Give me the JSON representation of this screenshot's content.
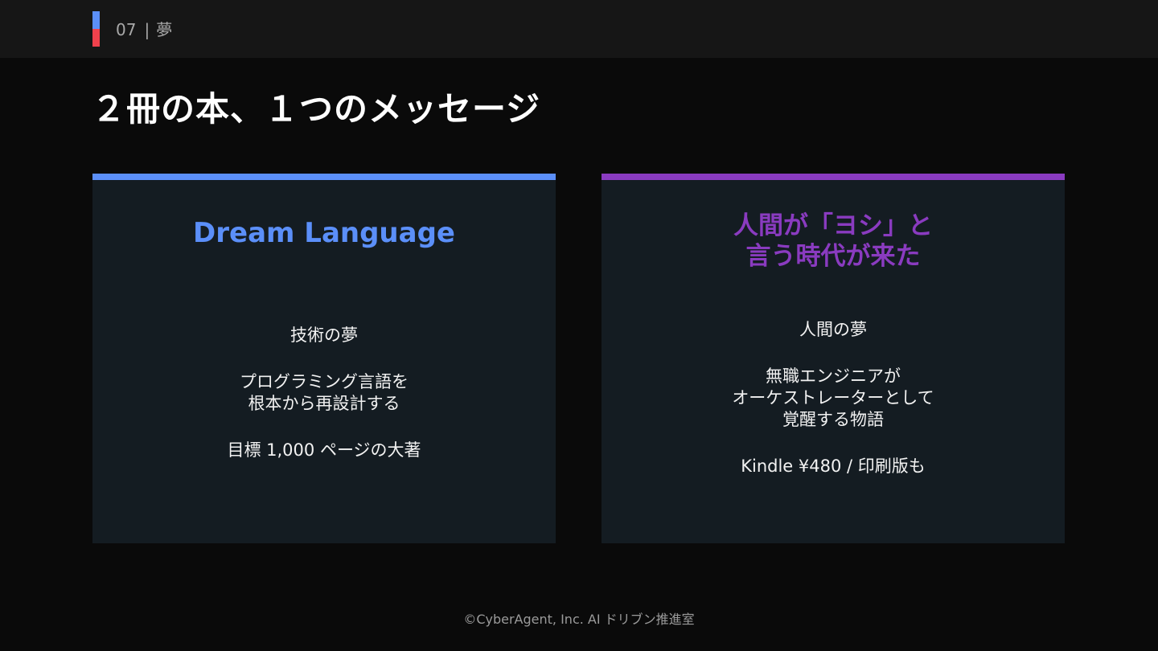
{
  "header": {
    "section_number": "07",
    "separator": "|",
    "section_name": "夢",
    "marker_colors": [
      "#5b8ff9",
      "#f0414c"
    ]
  },
  "title": "２冊の本、１つのメッセージ",
  "cards": [
    {
      "accent_color": "#5b8ff9",
      "heading_lines": [
        "Dream Language"
      ],
      "paragraphs": [
        [
          "技術の夢"
        ],
        [
          "プログラミング言語を",
          "根本から再設計する"
        ],
        [
          "目標 1,000 ページの大著"
        ]
      ]
    },
    {
      "accent_color": "#8a3bc0",
      "heading_lines": [
        "人間が「ヨシ」と",
        "言う時代が来た"
      ],
      "paragraphs": [
        [
          "人間の夢"
        ],
        [
          "無職エンジニアが",
          "オーケストレーターとして",
          "覚醒する物語"
        ],
        [
          "Kindle ¥480 /  印刷版も"
        ]
      ]
    }
  ],
  "footer": "©CyberAgent, Inc. AI ドリブン推進室"
}
